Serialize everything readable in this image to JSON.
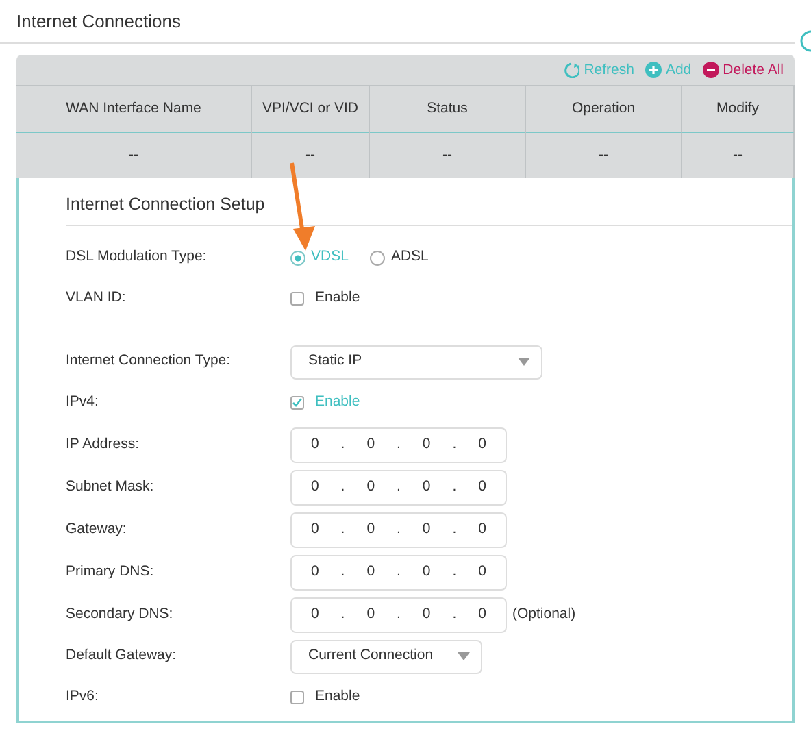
{
  "page_title": "Internet Connections",
  "toolbar": [
    {
      "kind": "refresh",
      "label": "Refresh"
    },
    {
      "kind": "add",
      "label": "Add"
    },
    {
      "kind": "delete",
      "label": "Delete All"
    }
  ],
  "table": {
    "columns": [
      "WAN Interface Name",
      "VPI/VCI or VID",
      "Status",
      "Operation",
      "Modify"
    ],
    "rows": [
      [
        "--",
        "--",
        "--",
        "--",
        "--"
      ]
    ]
  },
  "setup": {
    "title": "Internet Connection Setup",
    "groups": [
      [
        {
          "kind": "radio",
          "label": "DSL Modulation Type:",
          "options": [
            {
              "label": "VDSL",
              "selected": true
            },
            {
              "label": "ADSL",
              "selected": false
            }
          ]
        },
        {
          "kind": "checkbox",
          "label": "VLAN ID:",
          "text": "Enable",
          "checked": false
        }
      ],
      [
        {
          "kind": "select",
          "label": "Internet Connection Type:",
          "value": "Static IP",
          "wide": true
        },
        {
          "kind": "checkbox",
          "label": "IPv4:",
          "text": "Enable",
          "checked": true
        },
        {
          "kind": "ip",
          "label": "IP Address:",
          "parts": [
            "0",
            ".",
            "0",
            ".",
            "0",
            ".",
            "0"
          ]
        },
        {
          "kind": "ip",
          "label": "Subnet Mask:",
          "parts": [
            "0",
            ".",
            "0",
            ".",
            "0",
            ".",
            "0"
          ]
        },
        {
          "kind": "ip",
          "label": "Gateway:",
          "parts": [
            "0",
            ".",
            "0",
            ".",
            "0",
            ".",
            "0"
          ]
        },
        {
          "kind": "ip",
          "label": "Primary DNS:",
          "parts": [
            "0",
            ".",
            "0",
            ".",
            "0",
            ".",
            "0"
          ]
        },
        {
          "kind": "ip",
          "label": "Secondary DNS:",
          "parts": [
            "0",
            ".",
            "0",
            ".",
            "0",
            ".",
            "0"
          ],
          "note": "(Optional)"
        },
        {
          "kind": "select",
          "label": "Default Gateway:",
          "value": "Current Connection",
          "wide": false
        },
        {
          "kind": "checkbox",
          "label": "IPv6:",
          "text": "Enable",
          "checked": false
        }
      ]
    ]
  },
  "annotation": {
    "kind": "arrow"
  }
}
